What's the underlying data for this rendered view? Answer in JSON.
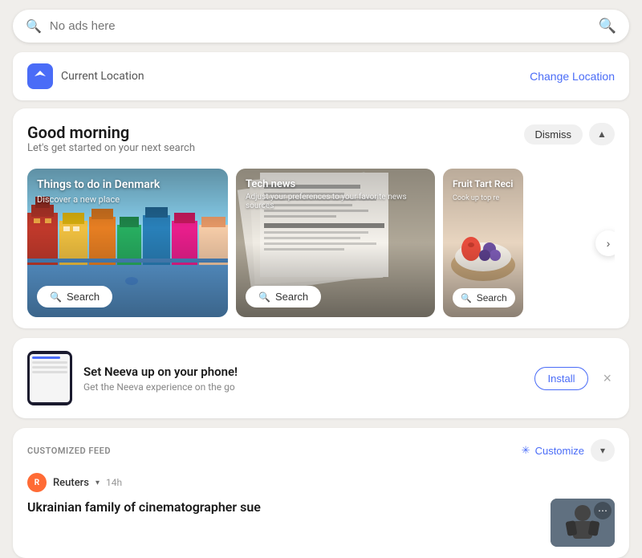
{
  "searchBar": {
    "placeholder": "No ads here",
    "value": ""
  },
  "locationBar": {
    "label": "Current Location",
    "changeButton": "Change Location",
    "iconColor": "#4a6cf7"
  },
  "morningCard": {
    "title": "Good morning",
    "subtitle": "Let's get started on your next search",
    "dismissLabel": "Dismiss",
    "collapseIcon": "▲"
  },
  "suggestionCards": [
    {
      "id": "denmark",
      "title": "Things to do in Denmark",
      "subtitle": "Discover a new place",
      "searchLabel": "Search",
      "type": "denmark"
    },
    {
      "id": "tech",
      "title": "Tech news",
      "subtitle": "Adjust your preferences to your favorite news sources",
      "searchLabel": "Search",
      "type": "newspaper"
    },
    {
      "id": "fruit",
      "title": "Fruit Tart Reci",
      "subtitle": "Cook up top re",
      "searchLabel": "Search",
      "type": "food"
    }
  ],
  "nextArrow": "›",
  "installBanner": {
    "title": "Set Neeva up on your phone!",
    "subtitle": "Get the Neeva experience on the go",
    "installLabel": "Install",
    "closeIcon": "×"
  },
  "feedSection": {
    "label": "CUSTOMIZED FEED",
    "customizeLabel": "Customize",
    "customizeIcon": "✳",
    "expandIcon": "▾"
  },
  "article": {
    "source": "Reuters",
    "sourceInitial": "R",
    "dropdownIcon": "▾",
    "time": "14h",
    "title": "Ukrainian family of cinematographer sue",
    "moreIcon": "⋯"
  }
}
